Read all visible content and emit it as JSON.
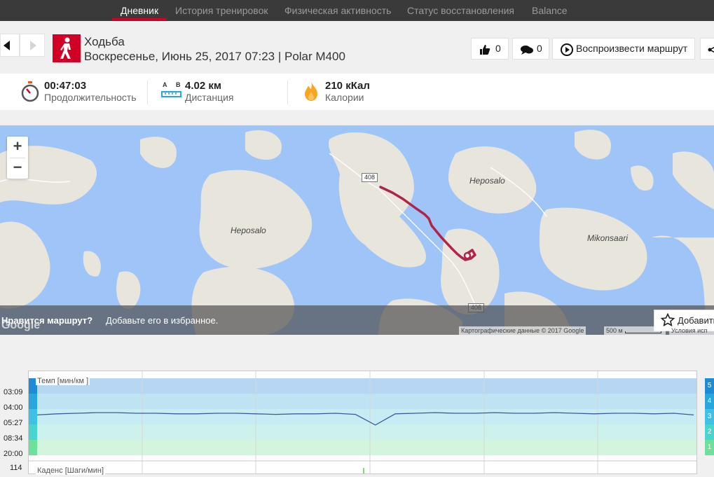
{
  "nav": {
    "tabs": [
      {
        "label": "Дневник",
        "active": true
      },
      {
        "label": "История тренировок",
        "active": false
      },
      {
        "label": "Физическая активность",
        "active": false
      },
      {
        "label": "Статус восстановления",
        "active": false
      },
      {
        "label": "Balance",
        "active": false
      }
    ]
  },
  "session": {
    "sport": "Ходьба",
    "subtitle": "Воскресенье, Июнь 25, 2017 07:23 | Polar M400",
    "likes": "0",
    "comments": "0",
    "replay_label": "Воспроизвести маршрут"
  },
  "stats": {
    "duration": {
      "value": "00:47:03",
      "label": "Продолжительность"
    },
    "distance": {
      "value": "4.02 км",
      "label": "Дистанция",
      "icon_a": "A",
      "icon_b": "B"
    },
    "calories": {
      "value": "210 кКал",
      "label": "Калории"
    }
  },
  "map": {
    "labels": [
      "Heposalo",
      "Heposalo",
      "Mikonsaari"
    ],
    "road_badges": [
      "408",
      "408"
    ],
    "zoom_in": "+",
    "zoom_out": "−",
    "fav_question": "Нравится маршрут?",
    "fav_text": "Добавьте его в избранное.",
    "fav_button": "Добавить",
    "google_logo": "Google",
    "credits": "Картографические данные © 2017 Google",
    "scale": "500 м",
    "terms": "Условия исп",
    "route_color": "#b0244a"
  },
  "chart": {
    "pace_label": "Темп [мин/км ]",
    "cadence_label": "Каденс [Шаги/мин]",
    "y_ticks": [
      "03:09",
      "04:00",
      "05:27",
      "08:34",
      "20:00"
    ],
    "cadence_tick": "114",
    "zones": [
      "5",
      "4",
      "3",
      "2",
      "1"
    ],
    "zone_colors": [
      "#1f8ad6",
      "#2aa6df",
      "#3fc0e6",
      "#4ad4d0",
      "#6fdf9c"
    ],
    "line_color": "#3b5aa0"
  },
  "chart_data": {
    "type": "line",
    "title": "Темп [мин/км ]",
    "ylabel": "",
    "series": [
      {
        "name": "Темп",
        "values": [
          7.4,
          7.2,
          7.1,
          7.0,
          7.0,
          7.1,
          7.1,
          7.2,
          7.2,
          7.1,
          7.1,
          7.2,
          7.3,
          7.2,
          7.2,
          7.1,
          7.3,
          9.5,
          7.2,
          7.1,
          7.0,
          7.1,
          7.1,
          7.0,
          7.1,
          7.1,
          7.0,
          7.1,
          7.2,
          7.1,
          7.1,
          7.2,
          7.1,
          7.4
        ]
      }
    ]
  }
}
